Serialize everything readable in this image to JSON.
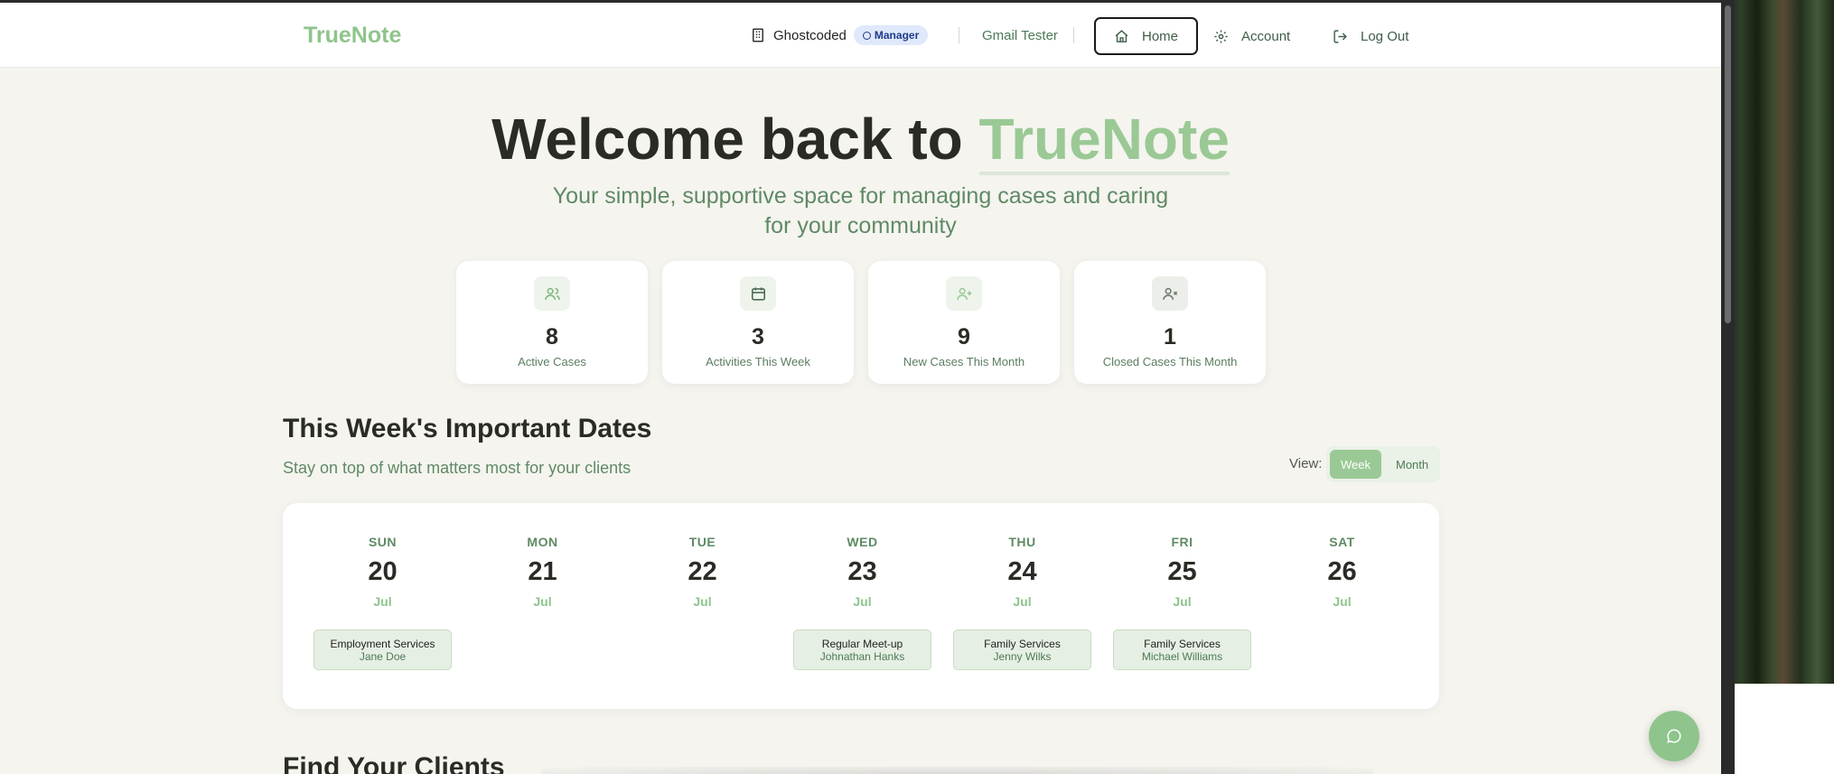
{
  "header": {
    "brand": "TrueNote",
    "org_name": "Ghostcoded",
    "role_badge": "Manager",
    "user_name": "Gmail Tester",
    "nav": {
      "home": "Home",
      "account": "Account",
      "logout": "Log Out"
    }
  },
  "hero": {
    "title_prefix": "Welcome back to ",
    "title_accent": "TrueNote",
    "subtitle": "Your simple, supportive space for managing cases and caring for your community"
  },
  "stats": [
    {
      "value": "8",
      "label": "Active Cases",
      "icon": "users-icon"
    },
    {
      "value": "3",
      "label": "Activities This Week",
      "icon": "calendar-icon"
    },
    {
      "value": "9",
      "label": "New Cases This Month",
      "icon": "user-plus-icon"
    },
    {
      "value": "1",
      "label": "Closed Cases This Month",
      "icon": "user-x-icon"
    }
  ],
  "dates": {
    "title": "This Week's Important Dates",
    "subtitle": "Stay on top of what matters most for your clients",
    "view_label": "View:",
    "view_options": {
      "week": "Week",
      "month": "Month"
    },
    "selected_view": "Week",
    "days": [
      {
        "dow": "SUN",
        "num": "20",
        "month": "Jul",
        "event": {
          "type": "Employment Services",
          "client": "Jane Doe"
        }
      },
      {
        "dow": "MON",
        "num": "21",
        "month": "Jul"
      },
      {
        "dow": "TUE",
        "num": "22",
        "month": "Jul"
      },
      {
        "dow": "WED",
        "num": "23",
        "month": "Jul",
        "event": {
          "type": "Regular Meet-up",
          "client": "Johnathan Hanks"
        }
      },
      {
        "dow": "THU",
        "num": "24",
        "month": "Jul",
        "event": {
          "type": "Family Services",
          "client": "Jenny Wilks"
        }
      },
      {
        "dow": "FRI",
        "num": "25",
        "month": "Jul",
        "event": {
          "type": "Family Services",
          "client": "Michael Williams"
        }
      },
      {
        "dow": "SAT",
        "num": "26",
        "month": "Jul"
      }
    ]
  },
  "find": {
    "title": "Find Your Clients"
  },
  "colors": {
    "accent": "#8fc48c",
    "text_green": "#5f8a65",
    "background": "#f5f4ef",
    "badge_bg": "#dfe9fb"
  }
}
